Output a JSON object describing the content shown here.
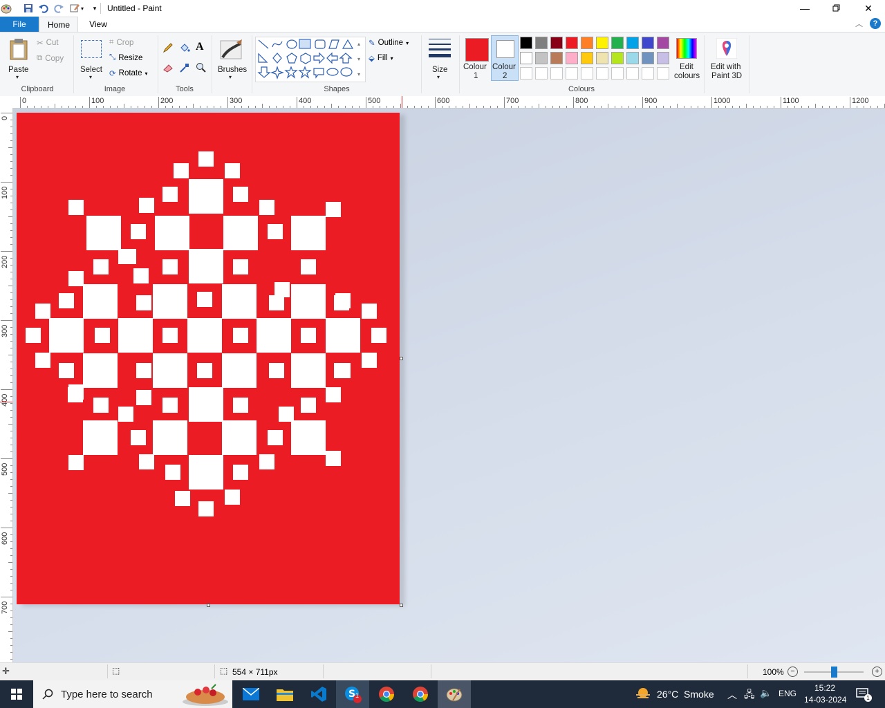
{
  "window": {
    "title": "Untitled - Paint"
  },
  "tabs": {
    "file": "File",
    "home": "Home",
    "view": "View"
  },
  "ribbon": {
    "clipboard": {
      "label": "Clipboard",
      "paste": "Paste",
      "cut": "Cut",
      "copy": "Copy"
    },
    "image": {
      "label": "Image",
      "select": "Select",
      "crop": "Crop",
      "resize": "Resize",
      "rotate": "Rotate"
    },
    "tools": {
      "label": "Tools"
    },
    "brushes": {
      "label": "Brushes"
    },
    "shapes": {
      "label": "Shapes",
      "outline": "Outline",
      "fill": "Fill"
    },
    "size": {
      "label": "Size"
    },
    "colours": {
      "label": "Colours",
      "colour1_line1": "Colour",
      "colour1_line2": "1",
      "colour2_line1": "Colour",
      "colour2_line2": "2",
      "colour1": "#ec1c24",
      "colour2": "#ffffff",
      "edit_line1": "Edit",
      "edit_line2": "colours",
      "paint3d_line1": "Edit with",
      "paint3d_line2": "Paint 3D",
      "palette_row1": [
        "#000000",
        "#7f7f7f",
        "#880015",
        "#ed1c24",
        "#ff7f27",
        "#fff200",
        "#22b14c",
        "#00a2e8",
        "#3f48cc",
        "#a349a4"
      ],
      "palette_row2": [
        "#ffffff",
        "#c3c3c3",
        "#b97a57",
        "#ffaec9",
        "#ffc90e",
        "#efe4b0",
        "#b5e61d",
        "#99d9ea",
        "#7092be",
        "#c8bfe7"
      ]
    }
  },
  "ruler": {
    "h_labels": [
      "0",
      "100",
      "200",
      "300",
      "400",
      "500",
      "600",
      "700",
      "800",
      "900",
      "1000",
      "1100",
      "1200"
    ],
    "v_labels": [
      "0",
      "100",
      "200",
      "300",
      "400",
      "500",
      "600",
      "700"
    ]
  },
  "status": {
    "dimensions": "554 × 711px",
    "zoom": "100%"
  },
  "taskbar": {
    "search_placeholder": "Type here to search",
    "weather": "26°C  Smoke",
    "language": "ENG",
    "time": "15:22",
    "date": "14-03-2024",
    "notification_count": "1",
    "skype_badge": "1"
  }
}
